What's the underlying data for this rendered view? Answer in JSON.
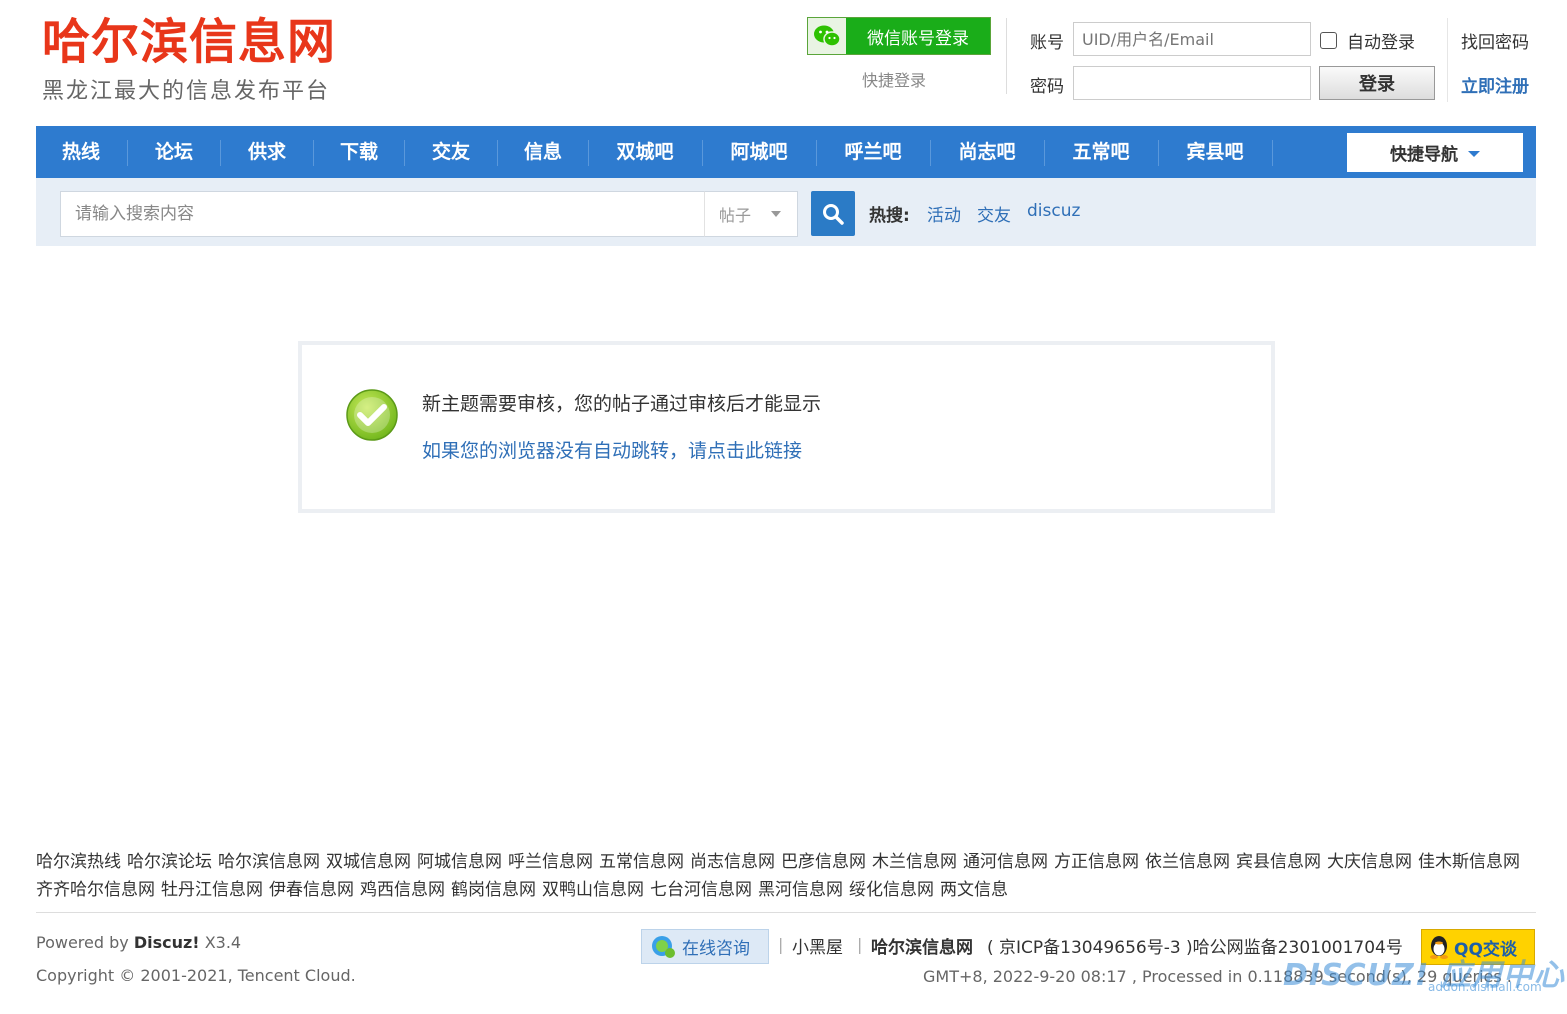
{
  "header": {
    "site_title": "哈尔滨信息网",
    "slogan": "黑龙江最大的信息发布平台",
    "wechat_login_label": "微信账号登录",
    "quick_login": "快捷登录",
    "account_label": "账号",
    "account_placeholder": "UID/用户名/Email",
    "password_label": "密码",
    "auto_login_label": "自动登录",
    "login_button": "登录",
    "forgot_password": "找回密码",
    "register": "立即注册"
  },
  "nav": {
    "items": [
      "热线",
      "论坛",
      "供求",
      "下载",
      "交友",
      "信息",
      "双城吧",
      "阿城吧",
      "呼兰吧",
      "尚志吧",
      "五常吧",
      "宾县吧"
    ],
    "quick_nav": "快捷导航"
  },
  "search": {
    "placeholder": "请输入搜索内容",
    "type_selected": "帖子",
    "hot_label": "热搜:",
    "hot_terms": [
      "活动",
      "交友",
      "discuz"
    ]
  },
  "message": {
    "text": "新主题需要审核，您的帖子通过审核后才能显示",
    "link": "如果您的浏览器没有自动跳转，请点击此链接"
  },
  "footer": {
    "friend_links": [
      "哈尔滨热线",
      "哈尔滨论坛",
      "哈尔滨信息网",
      "双城信息网",
      "阿城信息网",
      "呼兰信息网",
      "五常信息网",
      "尚志信息网",
      "巴彦信息网",
      "木兰信息网",
      "通河信息网",
      "方正信息网",
      "依兰信息网",
      "宾县信息网",
      "大庆信息网",
      "佳木斯信息网",
      "齐齐哈尔信息网",
      "牡丹江信息网",
      "伊春信息网",
      "鸡西信息网",
      "鹤岗信息网",
      "双鸭山信息网",
      "七台河信息网",
      "黑河信息网",
      "绥化信息网",
      "两文信息"
    ],
    "powered_prefix": "Powered by ",
    "powered_brand": "Discuz!",
    "powered_version": " X3.4",
    "copyright": "Copyright © 2001-2021, Tencent Cloud.",
    "consult_button": "在线咨询",
    "separator": "|",
    "xiaoheiwu": "小黑屋",
    "site_name": "哈尔滨信息网",
    "icp": "( 京ICP备13049656号-3 )哈公网监备2301001704号",
    "qq_button": "QQ交谈",
    "stats": "GMT+8, 2022-9-20 08:17 , Processed in 0.118839 second(s), 29 queries .",
    "watermark": "DISCUZ! 应用中心",
    "watermark_url": "addon.dismall.com"
  },
  "colors": {
    "brand_red": "#e8361a",
    "nav_blue": "#2e7bcf",
    "link_blue": "#2f6fb7",
    "wechat_green": "#1aad19",
    "qq_yellow": "#ffd200"
  }
}
